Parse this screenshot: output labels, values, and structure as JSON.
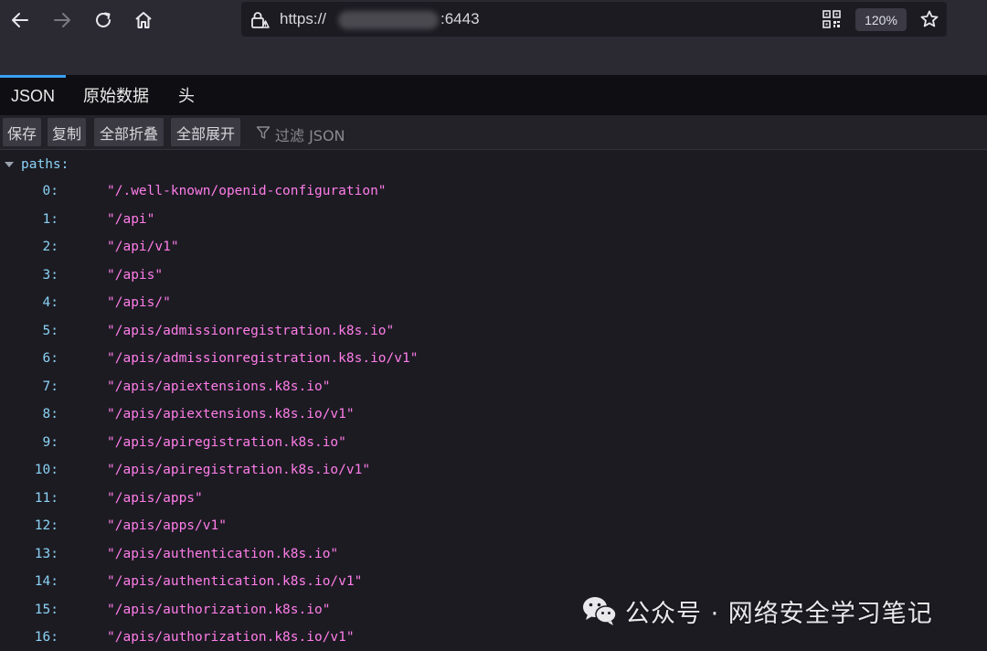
{
  "browser": {
    "url_prefix": "https://",
    "url_port": ":6443",
    "zoom_level": "120%"
  },
  "tabs": [
    {
      "label": "JSON",
      "active": true
    },
    {
      "label": "原始数据",
      "active": false
    },
    {
      "label": "头",
      "active": false
    }
  ],
  "actions": {
    "save": "保存",
    "copy": "复制",
    "collapse_all": "全部折叠",
    "expand_all": "全部展开",
    "filter_placeholder": "过滤 JSON"
  },
  "json": {
    "root_key": "paths:",
    "items": [
      {
        "index": "0:",
        "value": "\"/.well-known/openid-configuration\""
      },
      {
        "index": "1:",
        "value": "\"/api\""
      },
      {
        "index": "2:",
        "value": "\"/api/v1\""
      },
      {
        "index": "3:",
        "value": "\"/apis\""
      },
      {
        "index": "4:",
        "value": "\"/apis/\""
      },
      {
        "index": "5:",
        "value": "\"/apis/admissionregistration.k8s.io\""
      },
      {
        "index": "6:",
        "value": "\"/apis/admissionregistration.k8s.io/v1\""
      },
      {
        "index": "7:",
        "value": "\"/apis/apiextensions.k8s.io\""
      },
      {
        "index": "8:",
        "value": "\"/apis/apiextensions.k8s.io/v1\""
      },
      {
        "index": "9:",
        "value": "\"/apis/apiregistration.k8s.io\""
      },
      {
        "index": "10:",
        "value": "\"/apis/apiregistration.k8s.io/v1\""
      },
      {
        "index": "11:",
        "value": "\"/apis/apps\""
      },
      {
        "index": "12:",
        "value": "\"/apis/apps/v1\""
      },
      {
        "index": "13:",
        "value": "\"/apis/authentication.k8s.io\""
      },
      {
        "index": "14:",
        "value": "\"/apis/authentication.k8s.io/v1\""
      },
      {
        "index": "15:",
        "value": "\"/apis/authorization.k8s.io\""
      },
      {
        "index": "16:",
        "value": "\"/apis/authorization.k8s.io/v1\""
      }
    ]
  },
  "watermark": {
    "text": "公众号 · 网络安全学习笔记"
  },
  "colors": {
    "key": "#8bd3f7",
    "string": "#ff7de9",
    "tab_accent": "#3aa0f3"
  },
  "icons": {
    "back": "arrow-left-icon",
    "forward": "arrow-right-icon",
    "reload": "reload-icon",
    "home": "home-icon",
    "lock": "lock-warning-icon",
    "qr": "qr-code-icon",
    "bookmark": "star-icon",
    "filter": "filter-icon",
    "twisty": "chevron-down-icon",
    "wechat": "wechat-icon"
  }
}
